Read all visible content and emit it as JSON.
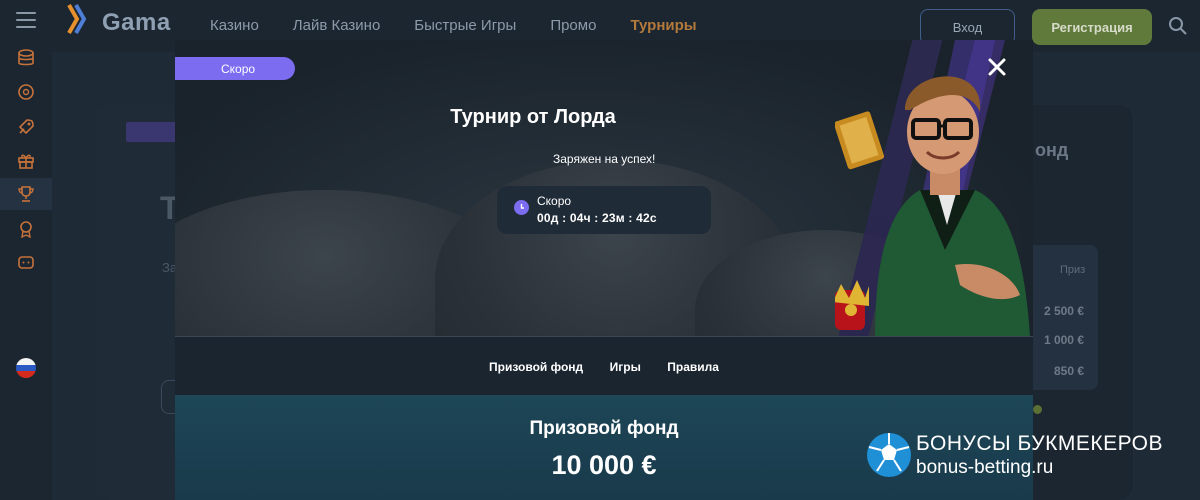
{
  "header": {
    "logo_text": "Gama",
    "nav": [
      "Казино",
      "Лайв Казино",
      "Быстрые Игры",
      "Промо",
      "Турниры"
    ],
    "active_nav": "Турниры",
    "login_label": "Вход",
    "register_label": "Регистрация",
    "search_icon": "search-icon"
  },
  "sidebar": {
    "icons": [
      "coins-icon",
      "wallet-icon",
      "rocket-icon",
      "gift-icon",
      "trophy-icon",
      "award-icon",
      "chat-icon"
    ],
    "active": "trophy-icon",
    "language_flag": "ru-flag-icon"
  },
  "background_page": {
    "prize_header": "Приз",
    "prizes": [
      "2 500 €",
      "1 000 €",
      "850 €"
    ],
    "fund_fragment": "онд"
  },
  "modal": {
    "badge": "Скоро",
    "title": "Турнир от Лорда",
    "subtitle": "Заряжен на успех!",
    "timer": {
      "label": "Скоро",
      "value": "00д : 04ч : 23м : 42с"
    },
    "tabs": [
      "Призовой фонд",
      "Игры",
      "Правила"
    ],
    "prize_fund": {
      "title": "Призовой фонд",
      "value": "10 000 €"
    }
  },
  "watermark": {
    "line1": "БОНУСЫ БУКМЕКЕРОВ",
    "line2": "bonus-betting.ru"
  },
  "colors": {
    "accent_purple": "#7b6cf0",
    "register_green": "#607a3b",
    "active_nav": "#b37a3b",
    "prize_panel": "#1d4657"
  }
}
